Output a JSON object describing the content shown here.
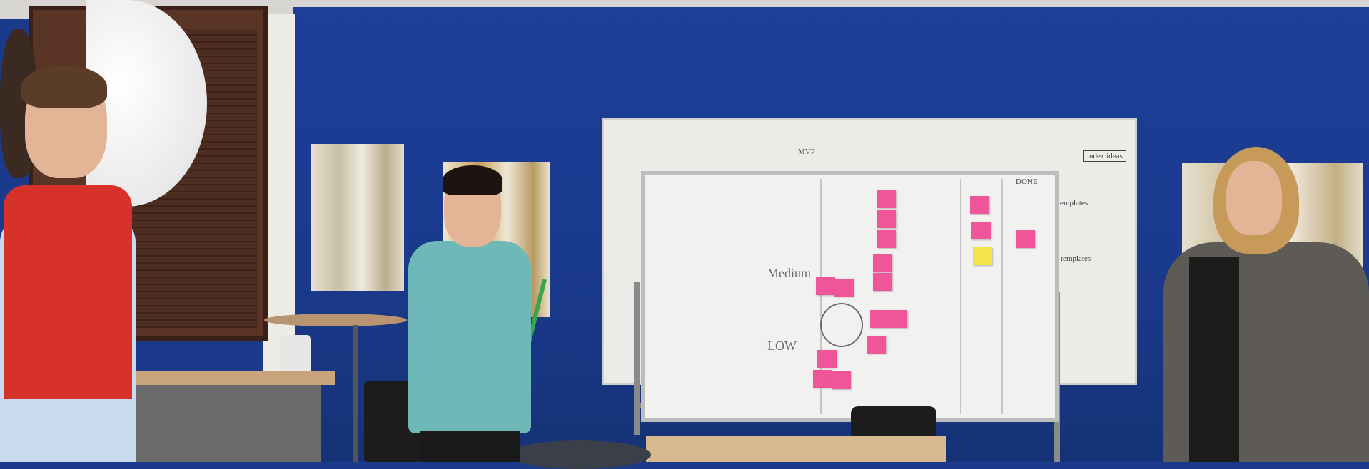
{
  "scene": {
    "description_colors": {
      "wall": "#1d3f98",
      "whiteboard": "#f1f1ef",
      "sticky_pink": "#f0559a",
      "sticky_yellow": "#f2e44a"
    }
  },
  "whiteboard_back": {
    "notes": [
      "index ideas",
      "templates",
      "templates",
      "MVP"
    ]
  },
  "whiteboard_front": {
    "notes": [
      "Medium",
      "LOW",
      "DONE"
    ]
  }
}
